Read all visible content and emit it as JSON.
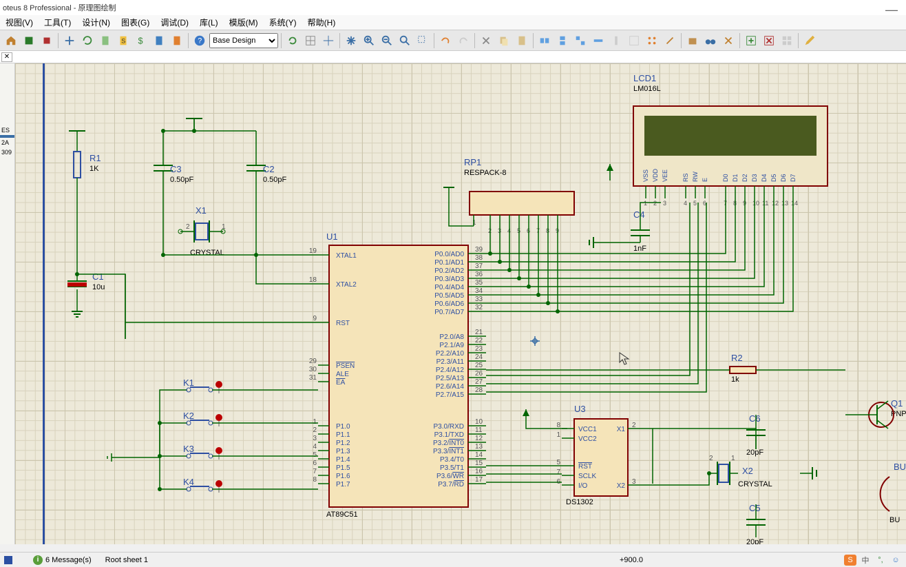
{
  "app": {
    "title": "oteus 8 Professional - 原理图绘制"
  },
  "menu": {
    "view": "视图(V)",
    "tool": "工具(T)",
    "design": "设计(N)",
    "chart": "图表(G)",
    "debug": "调试(D)",
    "lib": "库(L)",
    "template": "模版(M)",
    "system": "系统(Y)",
    "help": "帮助(H)"
  },
  "toolbar": {
    "design_selector": "Base Design"
  },
  "sidebar": {
    "s1": "ES",
    "s2": "",
    "s3": "2A",
    "s4": "309"
  },
  "components": {
    "R1": {
      "name": "R1",
      "value": "1K"
    },
    "R2": {
      "name": "R2",
      "value": "1k"
    },
    "C1": {
      "name": "C1",
      "value": "10u"
    },
    "C2": {
      "name": "C2",
      "value": "0.50pF"
    },
    "C3": {
      "name": "C3",
      "value": "0.50pF"
    },
    "C4": {
      "name": "C4",
      "value": "1nF"
    },
    "C5": {
      "name": "C5",
      "value": "20pF"
    },
    "C6": {
      "name": "C6",
      "value": "20pF"
    },
    "X1": {
      "name": "X1",
      "value": "CRYSTAL",
      "pin1": "1",
      "pin2": "2"
    },
    "X2": {
      "name": "X2",
      "value": "CRYSTAL",
      "pin1": "1",
      "pin2": "2"
    },
    "K1": {
      "name": "K1"
    },
    "K2": {
      "name": "K2"
    },
    "K3": {
      "name": "K3"
    },
    "K4": {
      "name": "K4"
    },
    "Q1": {
      "name": "Q1",
      "value": "PNP"
    },
    "BUZ": {
      "name": "BU",
      "value": "BU"
    },
    "RP1": {
      "name": "RP1",
      "value": "RESPACK-8",
      "pin1": "1",
      "pins": "2 3 4 5 6 7 8 9"
    },
    "LCD1": {
      "name": "LCD1",
      "value": "LM016L",
      "pins_left": [
        "VSS",
        "VDD",
        "VEE"
      ],
      "pins_mid": [
        "RS",
        "RW",
        "E"
      ],
      "pins_data": [
        "D0",
        "D1",
        "D2",
        "D3",
        "D4",
        "D5",
        "D6",
        "D7"
      ],
      "nums": [
        "1",
        "2",
        "3",
        "4",
        "5",
        "6",
        "7",
        "8",
        "9",
        "10",
        "11",
        "12",
        "13",
        "14"
      ]
    },
    "U1": {
      "name": "U1",
      "value": "AT89C51",
      "pins_left": [
        {
          "num": "19",
          "label": "XTAL1"
        },
        {
          "num": "18",
          "label": "XTAL2"
        },
        {
          "num": "9",
          "label": "RST"
        },
        {
          "num": "29",
          "label": "PSEN"
        },
        {
          "num": "30",
          "label": "ALE"
        },
        {
          "num": "31",
          "label": "EA"
        },
        {
          "num": "1",
          "label": "P1.0"
        },
        {
          "num": "2",
          "label": "P1.1"
        },
        {
          "num": "3",
          "label": "P1.2"
        },
        {
          "num": "4",
          "label": "P1.3"
        },
        {
          "num": "5",
          "label": "P1.4"
        },
        {
          "num": "6",
          "label": "P1.5"
        },
        {
          "num": "7",
          "label": "P1.6"
        },
        {
          "num": "8",
          "label": "P1.7"
        }
      ],
      "pins_right": [
        {
          "num": "39",
          "label": "P0.0/AD0"
        },
        {
          "num": "38",
          "label": "P0.1/AD1"
        },
        {
          "num": "37",
          "label": "P0.2/AD2"
        },
        {
          "num": "36",
          "label": "P0.3/AD3"
        },
        {
          "num": "35",
          "label": "P0.4/AD4"
        },
        {
          "num": "34",
          "label": "P0.5/AD5"
        },
        {
          "num": "33",
          "label": "P0.6/AD6"
        },
        {
          "num": "32",
          "label": "P0.7/AD7"
        },
        {
          "num": "21",
          "label": "P2.0/A8"
        },
        {
          "num": "22",
          "label": "P2.1/A9"
        },
        {
          "num": "23",
          "label": "P2.2/A10"
        },
        {
          "num": "24",
          "label": "P2.3/A11"
        },
        {
          "num": "25",
          "label": "P2.4/A12"
        },
        {
          "num": "26",
          "label": "P2.5/A13"
        },
        {
          "num": "27",
          "label": "P2.6/A14"
        },
        {
          "num": "28",
          "label": "P2.7/A15"
        },
        {
          "num": "10",
          "label": "P3.0/RXD"
        },
        {
          "num": "11",
          "label": "P3.1/TXD"
        },
        {
          "num": "12",
          "label": "P3.2/INT0"
        },
        {
          "num": "13",
          "label": "P3.3/INT1"
        },
        {
          "num": "14",
          "label": "P3.4/T0"
        },
        {
          "num": "15",
          "label": "P3.5/T1"
        },
        {
          "num": "16",
          "label": "P3.6/WR"
        },
        {
          "num": "17",
          "label": "P3.7/RD"
        }
      ]
    },
    "U3": {
      "name": "U3",
      "value": "DS1302",
      "pins_left": [
        {
          "num": "8",
          "label": "VCC1"
        },
        {
          "num": "1",
          "label": "VCC2"
        },
        {
          "num": "5",
          "label": "RST"
        },
        {
          "num": "7",
          "label": "SCLK"
        },
        {
          "num": "6",
          "label": "I/O"
        }
      ],
      "pins_right": [
        {
          "num": "2",
          "label": "X1"
        },
        {
          "num": "3",
          "label": "X2"
        }
      ]
    }
  },
  "status": {
    "messages": "6 Message(s)",
    "sheet": "Root sheet 1",
    "coord": "+900.0"
  }
}
